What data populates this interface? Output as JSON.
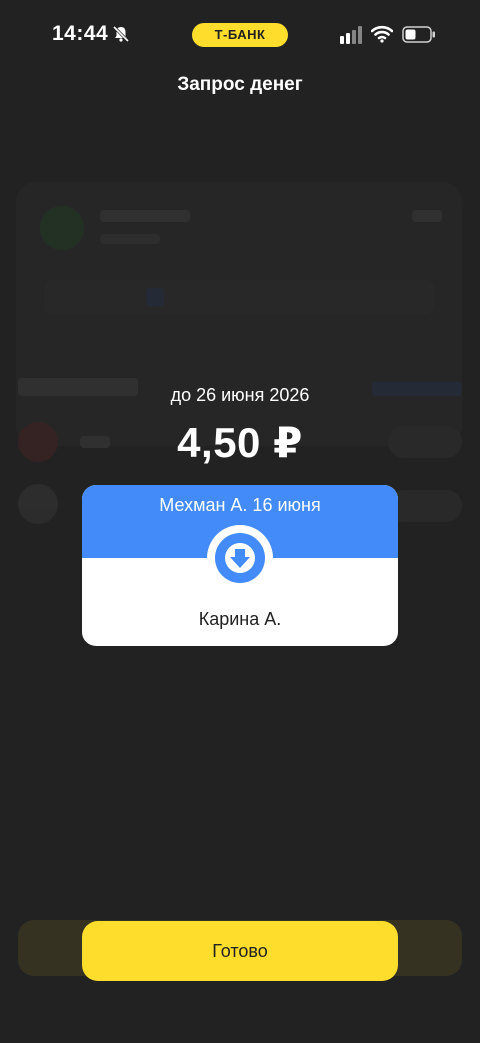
{
  "status_bar": {
    "time": "14:44",
    "brand": "Т-БАНК",
    "icons": [
      "bell-slash-icon",
      "signal-icon",
      "wifi-icon",
      "battery-icon"
    ]
  },
  "header": {
    "title": "Запрос денег"
  },
  "request": {
    "due_date": "до 26 июня 2026",
    "amount": "4,50 ₽",
    "sender_line": "Мехман А. 16 июня",
    "recipient": "Карина А.",
    "direction_icon": "arrow-down-icon"
  },
  "actions": {
    "done_label": "Готово"
  },
  "colors": {
    "background": "#222222",
    "accent_yellow": "#FFDD2D",
    "accent_blue": "#428BF9"
  }
}
